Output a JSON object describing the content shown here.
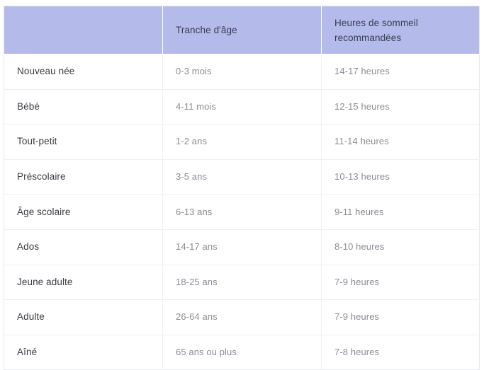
{
  "table": {
    "columns": [
      {
        "key": "stage",
        "header": ""
      },
      {
        "key": "age_range",
        "header": "Tranche d'âge"
      },
      {
        "key": "sleep_hours",
        "header_line1": "Heures de sommeil",
        "header_line2": "recommandées"
      }
    ],
    "header": {
      "col1": "",
      "col2": "Tranche d'âge",
      "col3_line1": "Heures de sommeil",
      "col3_line2": "recommandées"
    },
    "rows": [
      {
        "stage": "Nouveau née",
        "age_range": "0-3 mois",
        "sleep_hours": "14-17 heures"
      },
      {
        "stage": "Bébé",
        "age_range": "4-11 mois",
        "sleep_hours": "12-15 heures"
      },
      {
        "stage": "Tout-petit",
        "age_range": "1-2 ans",
        "sleep_hours": "11-14 heures"
      },
      {
        "stage": "Préscolaire",
        "age_range": "3-5 ans",
        "sleep_hours": "10-13 heures"
      },
      {
        "stage": "Âge scolaire",
        "age_range": "6-13 ans",
        "sleep_hours": "9-11 heures"
      },
      {
        "stage": "Ados",
        "age_range": "14-17 ans",
        "sleep_hours": "8-10 heures"
      },
      {
        "stage": "Jeune adulte",
        "age_range": "18-25 ans",
        "sleep_hours": "7-9 heures"
      },
      {
        "stage": "Adulte",
        "age_range": "26-64 ans",
        "sleep_hours": "7-9 heures"
      },
      {
        "stage": "Aîné",
        "age_range": "65 ans ou plus",
        "sleep_hours": "7-8 heures"
      }
    ]
  },
  "colors": {
    "header_background": "#b4bae9",
    "header_text": "#3a3d56",
    "stage_text": "#3c3c44",
    "value_text": "#8b8c96",
    "grid_line": "#eef0f4",
    "outer_border": "#e7e8ef",
    "page_background": "#ffffff"
  }
}
